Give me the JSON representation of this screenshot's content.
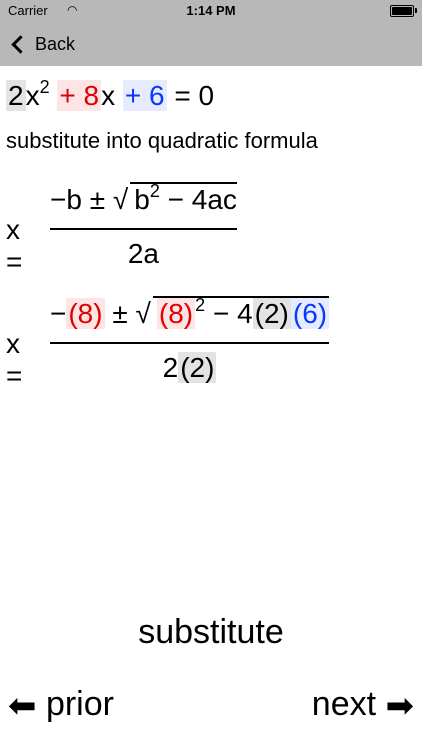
{
  "status_bar": {
    "carrier": "Carrier",
    "time": "1:14 PM"
  },
  "nav": {
    "back_label": "Back"
  },
  "equation": {
    "coef_a": "2",
    "var_x": "x",
    "exponent": "2",
    "plus1": "+",
    "coef_b": "8",
    "var_x2": "x",
    "plus2": "+",
    "const_c": "6",
    "equals": "=",
    "rhs": "0"
  },
  "instruction": "substitute into quadratic formula",
  "formula_general": {
    "lhs": "x =",
    "numerator_prefix": "−b ±",
    "b": "b",
    "b_exp": "2",
    "rest": "− 4ac",
    "denominator": "2a"
  },
  "formula_substituted": {
    "lhs": "x =",
    "neg": "−",
    "b_paren": "(8)",
    "pm": "±",
    "b_paren2": "(8)",
    "b_exp": "2",
    "minus4": "− 4",
    "a_paren": "(2)",
    "c_paren": "(6)",
    "den_prefix": "2",
    "den_a_paren": "(2)"
  },
  "footer": {
    "mode_label": "substitute",
    "prior_label": "prior",
    "next_label": "next",
    "left_arrow_icon": "⬅",
    "right_arrow_icon": "➡"
  },
  "colors": {
    "red": "#e00000",
    "blue": "#0a38ff",
    "navbar_gray": "#b8b8b8"
  }
}
